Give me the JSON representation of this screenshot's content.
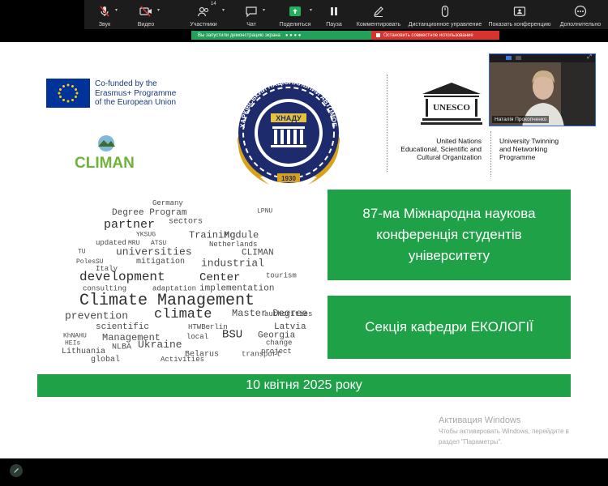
{
  "toolbar": {
    "items": [
      {
        "label": "Звук",
        "icon": "mic-muted-icon"
      },
      {
        "label": "Видео",
        "icon": "video-off-icon"
      },
      {
        "label": "Участники",
        "icon": "participants-icon",
        "count": "14"
      },
      {
        "label": "Чат",
        "icon": "chat-icon"
      },
      {
        "label": "Поделиться",
        "icon": "share-screen-icon"
      },
      {
        "label": "Пауза",
        "icon": "pause-icon"
      },
      {
        "label": "Комментировать",
        "icon": "annotate-icon"
      },
      {
        "label": "Дистанционное управление",
        "icon": "remote-control-icon"
      },
      {
        "label": "Показать конференцию",
        "icon": "show-meeting-icon"
      },
      {
        "label": "Дополнительно",
        "icon": "more-icon"
      }
    ]
  },
  "share": {
    "status": "Вы запустили демонстрацию экрана",
    "stop": "Остановить совместное использование"
  },
  "slide": {
    "eu_text": [
      "Co-funded by the",
      "Erasmus+ Programme",
      "of the European Union"
    ],
    "climan": "CLIMAN",
    "univ_ring": "ХАРКІВСЬКИЙ НАЦІОНАЛЬНИЙ АВТОМОБІЛЬНО-ДОРОЖНІЙ УНІВЕРСИТЕТ",
    "univ_abbr": "ХНАДУ",
    "univ_year": "1930",
    "unesco_word": "UNESCO",
    "un_text": [
      "United Nations",
      "Educational, Scientific and",
      "Cultural Organization"
    ],
    "twin_text": [
      "University Twinning",
      "and Networking",
      "Programme"
    ],
    "conference_title": "87-ма Міжнародна наукова конференція студентів університету",
    "section_title": "Секція кафедри ЕКОЛОГІЇ",
    "date": "10 квітня 2025 року",
    "wordcloud": [
      "Germany",
      "Degree Program",
      "partner",
      "sectors",
      "YKSUG",
      "Training",
      "Module",
      "MRU",
      "ATSU",
      "Netherlands",
      "updated",
      "universities",
      "CLIMAN",
      "TU",
      "PolesSU",
      "Italy",
      "mitigation",
      "industrial",
      "development",
      "Center",
      "tourism",
      "consulting",
      "adaptation",
      "implementation",
      "Climate Management",
      "prevention",
      "climate",
      "authorities",
      "Master Degree",
      "HTWBerlin",
      "Latvia",
      "scientific",
      "Georgia",
      "KhNAHU",
      "Management",
      "local",
      "BSU",
      "change",
      "HEIs",
      "NLBA",
      "Ukraine",
      "project",
      "Lithuania",
      "Belarus",
      "transport",
      "global",
      "Activities",
      "LPNU"
    ]
  },
  "video": {
    "participant_name": "Наталія Прокопченко"
  },
  "windows": {
    "title": "Активация Windows",
    "line1": "Чтобы активировать Windows, перейдите в",
    "line2": "раздел \"Параметры\"."
  },
  "colors": {
    "green": "#1fa247",
    "toolbar_bg": "#1c1c1c",
    "share_green": "#21a15a",
    "share_red": "#d9332d"
  }
}
